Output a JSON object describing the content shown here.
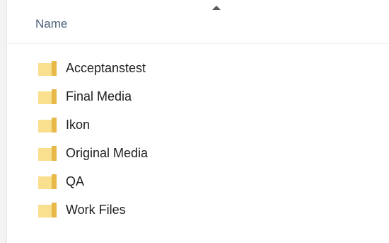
{
  "header": {
    "name_column_label": "Name",
    "sort_indicator": "sort-ascending-icon"
  },
  "files": [
    {
      "name": "Acceptanstest",
      "icon": "folder-icon"
    },
    {
      "name": "Final Media",
      "icon": "folder-icon"
    },
    {
      "name": "Ikon",
      "icon": "folder-icon"
    },
    {
      "name": "Original Media",
      "icon": "folder-icon"
    },
    {
      "name": "QA",
      "icon": "folder-icon"
    },
    {
      "name": "Work Files",
      "icon": "folder-icon"
    }
  ],
  "colors": {
    "folder_body": "#f7d77a",
    "folder_tab": "#e8b848",
    "header_text": "#4c607a",
    "item_text": "#1e1e1e"
  }
}
